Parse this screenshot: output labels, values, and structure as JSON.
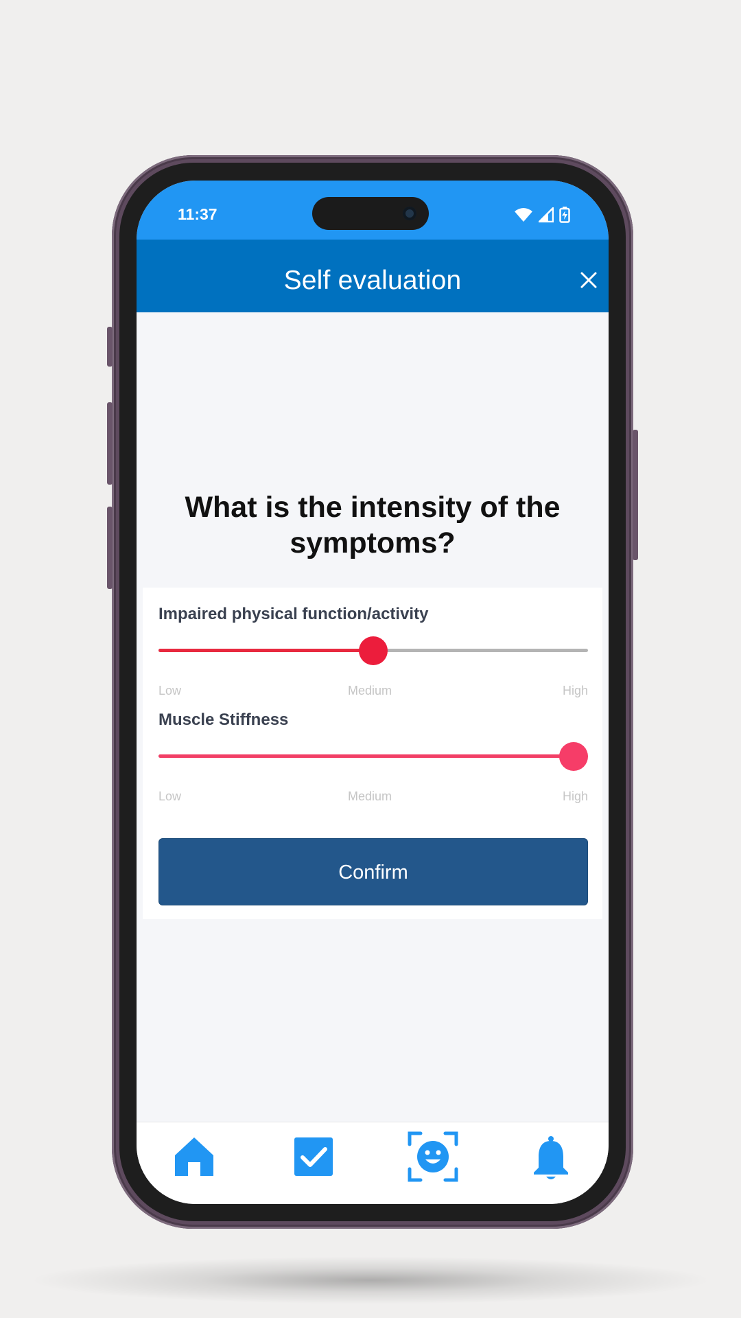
{
  "status_bar": {
    "time": "11:37"
  },
  "header": {
    "title": "Self evaluation",
    "close_icon": "close-icon"
  },
  "question": "What is the intensity of the symptoms?",
  "metrics": [
    {
      "label": "Impaired physical function/activity",
      "value_fraction": 0.5,
      "fill_color": "#e8293f",
      "thumb_color": "#ec1d3c"
    },
    {
      "label": "Muscle Stiffness",
      "value_fraction": 1.0,
      "fill_color": "#f23f66",
      "thumb_color": "#f63d68"
    }
  ],
  "scale": {
    "low": "Low",
    "medium": "Medium",
    "high": "High"
  },
  "confirm_label": "Confirm",
  "nav": [
    {
      "name": "home-icon"
    },
    {
      "name": "checkbox-icon"
    },
    {
      "name": "face-scan-icon"
    },
    {
      "name": "bell-icon"
    }
  ],
  "colors": {
    "status_bar": "#2196f3",
    "header": "#0071bf",
    "confirm": "#23578b",
    "nav_icon": "#2196f3"
  }
}
